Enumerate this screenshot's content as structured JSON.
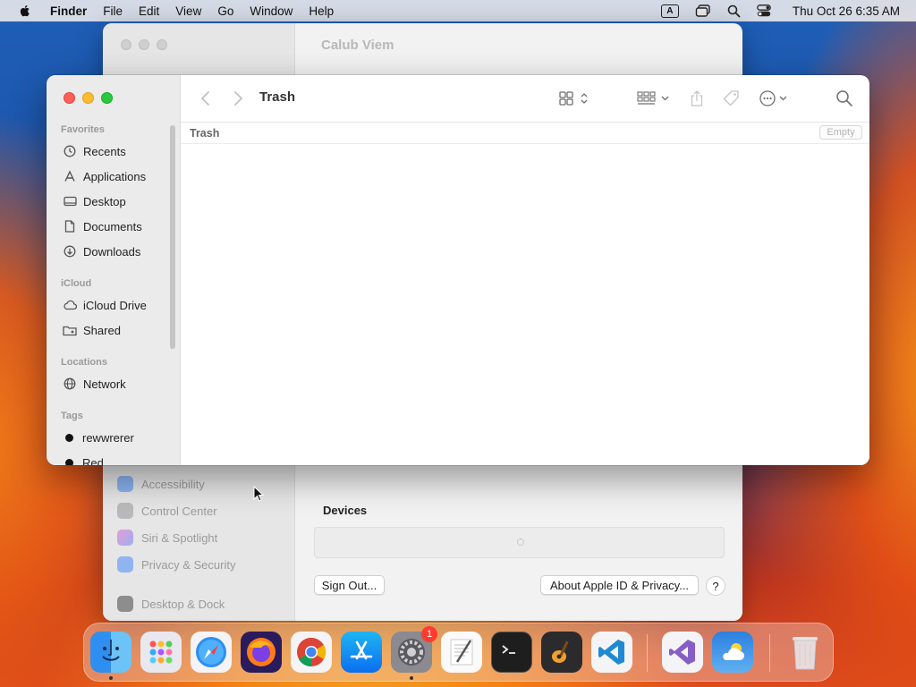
{
  "menubar": {
    "app_name": "Finder",
    "menus": [
      "File",
      "Edit",
      "View",
      "Go",
      "Window",
      "Help"
    ],
    "input_source": "A",
    "clock": "Thu Oct 26  6:35 AM"
  },
  "settings_window": {
    "title": "Calub Viem",
    "nav_items": [
      "Accessibility",
      "Control Center",
      "Siri & Spotlight",
      "Privacy & Security",
      "Desktop & Dock"
    ],
    "devices_label": "Devices",
    "sign_out_label": "Sign Out...",
    "about_label": "About Apple ID & Privacy...",
    "help_label": "?"
  },
  "finder": {
    "title": "Trash",
    "path_label": "Trash",
    "empty_button": "Empty",
    "sidebar": {
      "favorites_header": "Favorites",
      "favorites": [
        "Recents",
        "Applications",
        "Desktop",
        "Documents",
        "Downloads"
      ],
      "icloud_header": "iCloud",
      "icloud": [
        "iCloud Drive",
        "Shared"
      ],
      "locations_header": "Locations",
      "locations": [
        "Network"
      ],
      "tags_header": "Tags",
      "tags": [
        "rewwrerer",
        "Red"
      ]
    }
  },
  "dock": {
    "apps": [
      "Finder",
      "Launchpad",
      "Safari",
      "Firefox",
      "Chrome",
      "App Store",
      "System Settings",
      "TextEdit",
      "Terminal",
      "GarageBand",
      "Visual Studio Code",
      "Visual Studio",
      "Weather",
      "Trash"
    ],
    "settings_badge": "1"
  },
  "colors": {
    "close": "#fe5f57",
    "minimize": "#febc2e",
    "maximize": "#28c840"
  }
}
